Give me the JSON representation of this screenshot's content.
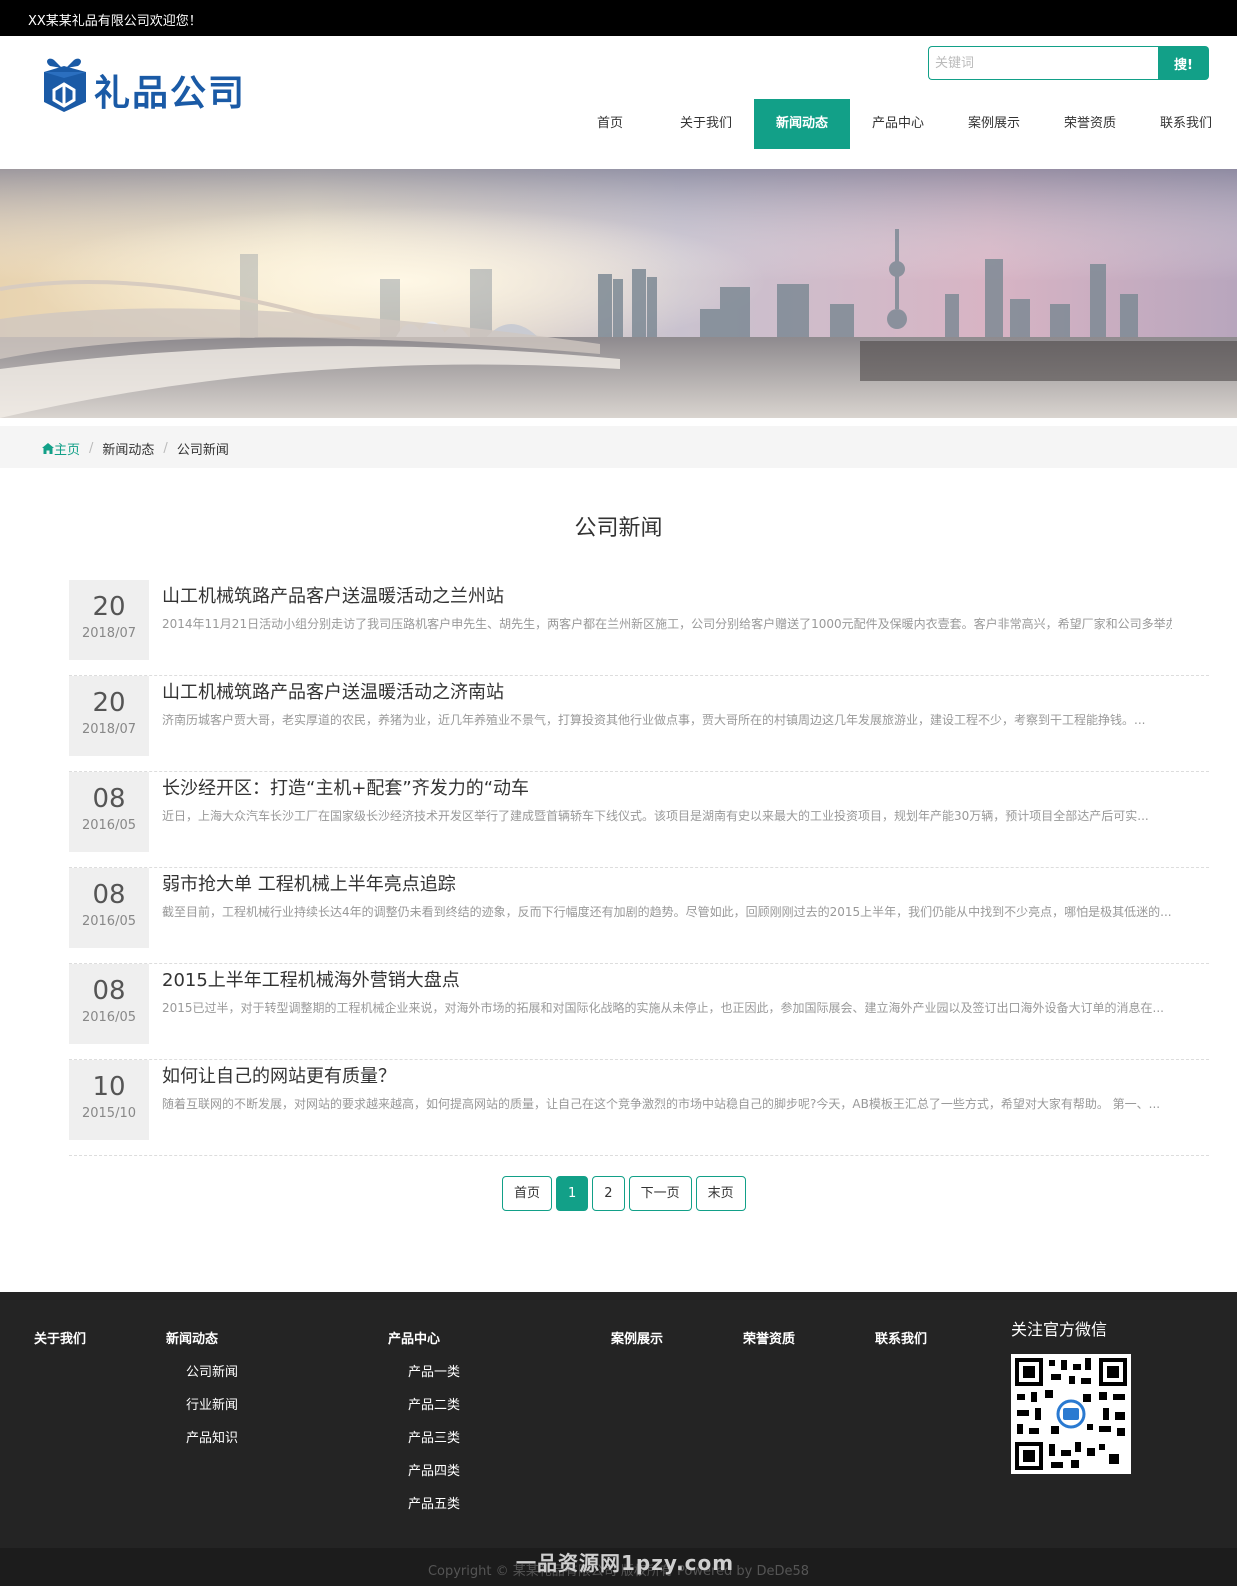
{
  "topbar": {
    "welcome": "XX某某礼品有限公司欢迎您！"
  },
  "header": {
    "logo_text": "礼品公司",
    "search": {
      "placeholder": "关键词",
      "button": "搜!"
    },
    "nav": [
      {
        "label": "首页",
        "active": false
      },
      {
        "label": "关于我们",
        "active": false
      },
      {
        "label": "新闻动态",
        "active": true
      },
      {
        "label": "产品中心",
        "active": false
      },
      {
        "label": "案例展示",
        "active": false
      },
      {
        "label": "荣誉资质",
        "active": false
      },
      {
        "label": "联系我们",
        "active": false
      }
    ]
  },
  "breadcrumb": {
    "home": "主页",
    "items": [
      "新闻动态",
      "公司新闻"
    ]
  },
  "main": {
    "title": "公司新闻",
    "news": [
      {
        "day": "20",
        "ym": "2018/07",
        "title": "山工机械筑路产品客户送温暖活动之兰州站",
        "desc": "2014年11月21日活动小组分别走访了我司压路机客户申先生、胡先生，两客户都在兰州新区施工，公司分别给客户赠送了1000元配件及保暖内衣壹套。客户非常高兴，希望厂家和公司多举办..."
      },
      {
        "day": "20",
        "ym": "2018/07",
        "title": "山工机械筑路产品客户送温暖活动之济南站",
        "desc": "济南历城客户贾大哥，老实厚道的农民，养猪为业，近几年养殖业不景气，打算投资其他行业做点事，贾大哥所在的村镇周边这几年发展旅游业，建设工程不少，考察到干工程能挣钱。..."
      },
      {
        "day": "08",
        "ym": "2016/05",
        "title": "长沙经开区：打造“主机+配套”齐发力的“动车",
        "desc": "近日，上海大众汽车长沙工厂在国家级长沙经济技术开发区举行了建成暨首辆轿车下线仪式。该项目是湖南有史以来最大的工业投资项目，规划年产能30万辆，预计项目全部达产后可实..."
      },
      {
        "day": "08",
        "ym": "2016/05",
        "title": "弱市抢大单 工程机械上半年亮点追踪",
        "desc": "截至目前，工程机械行业持续长达4年的调整仍未看到终结的迹象，反而下行幅度还有加剧的趋势。尽管如此，回顾刚刚过去的2015上半年，我们仍能从中找到不少亮点，哪怕是极其低迷的..."
      },
      {
        "day": "08",
        "ym": "2016/05",
        "title": "2015上半年工程机械海外营销大盘点",
        "desc": "2015已过半，对于转型调整期的工程机械企业来说，对海外市场的拓展和对国际化战略的实施从未停止，也正因此，参加国际展会、建立海外产业园以及签订出口海外设备大订单的消息在..."
      },
      {
        "day": "10",
        "ym": "2015/10",
        "title": "如何让自己的网站更有质量？",
        "desc": "随着互联网的不断发展，对网站的要求越来越高，如何提高网站的质量，让自己在这个竞争激烈的市场中站稳自己的脚步呢?今天，AB模板王汇总了一些方式，希望对大家有帮助。 第一、..."
      }
    ]
  },
  "pagination": [
    "首页",
    "1",
    "2",
    "下一页",
    "末页"
  ],
  "pagination_current": "1",
  "footer": {
    "columns": [
      {
        "heading": "关于我们",
        "links": []
      },
      {
        "heading": "新闻动态",
        "links": [
          "公司新闻",
          "行业新闻",
          "产品知识"
        ]
      },
      {
        "heading": "产品中心",
        "links": [
          "产品一类",
          "产品二类",
          "产品三类",
          "产品四类",
          "产品五类"
        ]
      },
      {
        "heading": "案例展示",
        "links": []
      },
      {
        "heading": "荣誉资质",
        "links": []
      },
      {
        "heading": "联系我们",
        "links": []
      }
    ],
    "wechat_title": "关注官方微信",
    "copyright": "Copyright © 某某礼品有限公司 版权所有 Powered by DeDe58"
  },
  "watermark": "一品资源网1pzy.com",
  "colors": {
    "accent": "#12a088",
    "logo": "#1a5aa6",
    "footer_bg": "#242424",
    "topbar_bg": "#000000"
  }
}
